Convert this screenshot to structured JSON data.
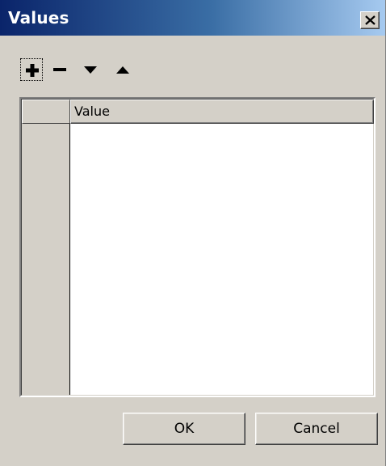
{
  "window": {
    "title": "Values",
    "close_glyph": "×"
  },
  "toolbar": {
    "buttons": [
      {
        "icon": "plus-icon",
        "label": "Add"
      },
      {
        "icon": "minus-icon",
        "label": "Remove"
      },
      {
        "icon": "arrow-down-icon",
        "label": "Move down"
      },
      {
        "icon": "arrow-up-icon",
        "label": "Move up"
      }
    ]
  },
  "grid": {
    "columns": [
      "Value"
    ],
    "rows": []
  },
  "buttons": {
    "ok_label": "OK",
    "cancel_label": "Cancel"
  },
  "colors": {
    "title_gradient_start": "#0a246a",
    "title_gradient_end": "#a6caf0",
    "face": "#d4d0c8"
  }
}
